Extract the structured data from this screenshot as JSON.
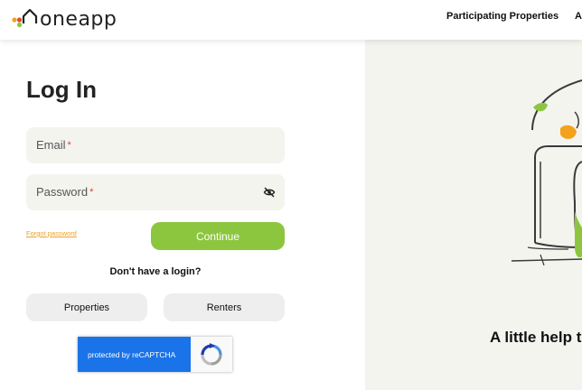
{
  "header": {
    "logo_text": "oneapp",
    "nav": [
      "Participating Properties",
      "A"
    ]
  },
  "login": {
    "title": "Log In",
    "email_label": "Email",
    "password_label": "Password",
    "required_mark": "*",
    "forgot_password": "Forgot password",
    "continue_label": "Continue",
    "no_login_text": "Don't have a login?",
    "properties_label": "Properties",
    "renters_label": "Renters"
  },
  "recaptcha": {
    "label": "protected by reCAPTCHA"
  },
  "right_panel": {
    "tagline": "A little help t"
  },
  "colors": {
    "accent": "#8cc63f",
    "link": "#e8a12a",
    "panel": "#f4f4ef",
    "recaptcha_blue": "#1a73e8"
  }
}
